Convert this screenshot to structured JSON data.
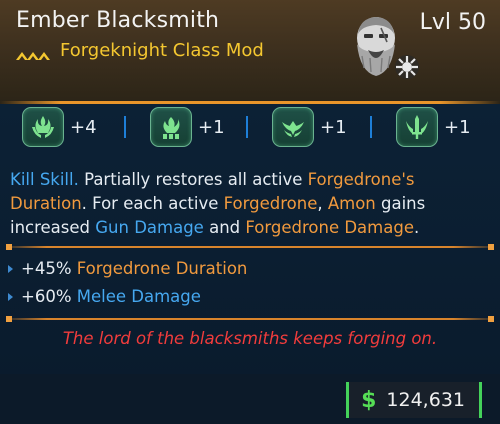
{
  "item": {
    "name": "Ember Blacksmith",
    "class_mod": "Forgeknight Class Mod",
    "level": "Lvl 50",
    "rarity_color": "#f4c730"
  },
  "skills": [
    {
      "icon": "flame-hands-icon",
      "value": "+4"
    },
    {
      "icon": "rising-flame-icon",
      "value": "+1"
    },
    {
      "icon": "wing-crest-icon",
      "value": "+1"
    },
    {
      "icon": "sword-crest-icon",
      "value": "+1"
    }
  ],
  "description": {
    "kill_skill": "Kill Skill.",
    "t1": " Partially restores all active ",
    "forgedrone_duration": "Forgedrone's Duration",
    "t2": ". For each active ",
    "forgedrone": "Forgedrone",
    "t3": ", ",
    "amon": "Amon",
    "t4": " gains increased ",
    "gun_damage": "Gun Damage",
    "t5": " and ",
    "forgedrone_damage": "Forgedrone Damage",
    "t6": "."
  },
  "bonuses": [
    {
      "amount": "+45%",
      "stat": "Forgedrone Duration",
      "stat_color": "#f19a3e"
    },
    {
      "amount": "+60%",
      "stat": "Melee Damage",
      "stat_color": "#46a8f0"
    }
  ],
  "flavor_text": "The lord of the blacksmiths keeps forging on.",
  "price": {
    "currency_symbol": "$",
    "value": "124,631"
  }
}
